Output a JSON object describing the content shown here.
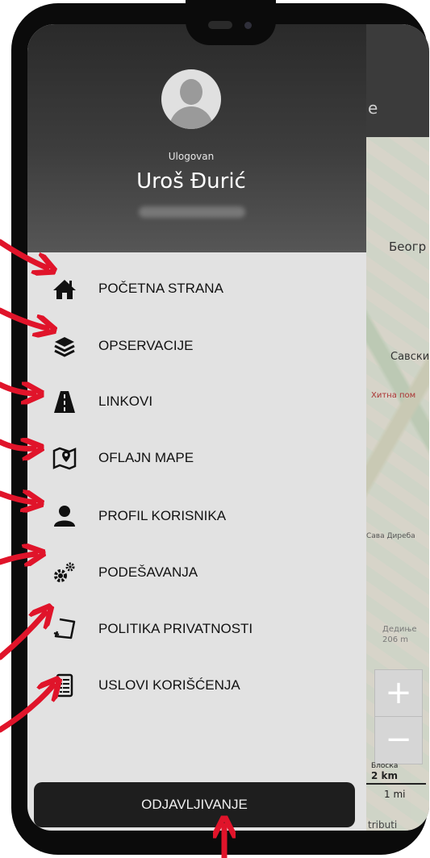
{
  "header": {
    "status_label": "Ulogovan",
    "user_name": "Uroš Đurić"
  },
  "menu": {
    "items": [
      {
        "label": "POČETNA STRANA",
        "icon": "home-icon"
      },
      {
        "label": "OPSERVACIJE",
        "icon": "layers-icon"
      },
      {
        "label": "LINKOVI",
        "icon": "road-icon"
      },
      {
        "label": "OFLAJN MAPE",
        "icon": "map-pin-icon"
      },
      {
        "label": "PROFIL KORISNIKA",
        "icon": "user-icon"
      },
      {
        "label": "PODEŠAVANJA",
        "icon": "gears-icon"
      },
      {
        "label": "POLITIKA PRIVATNOSTI",
        "icon": "document-icon"
      },
      {
        "label": "USLOVI KORIŠĆENJA",
        "icon": "list-icon"
      }
    ]
  },
  "logout_label": "ODJAVLJIVANJE",
  "map": {
    "labels": {
      "city": "Беогр",
      "district": "Савски",
      "road": "Хитна пом",
      "street": "Сава Диреба",
      "place": "Дедиње",
      "elevation": "206 m",
      "scale_km_label": "Блоска",
      "scale_km": "2 km",
      "scale_mi": "1 mi",
      "attribution": "tributi"
    },
    "zoom_in": "+",
    "zoom_out": "−",
    "header_partial": "e"
  },
  "colors": {
    "arrow": "#e0142a",
    "drawer_bg": "#e2e2e2",
    "header_dark": "#2a2a2a",
    "logout_bg": "#1e1e1e"
  }
}
